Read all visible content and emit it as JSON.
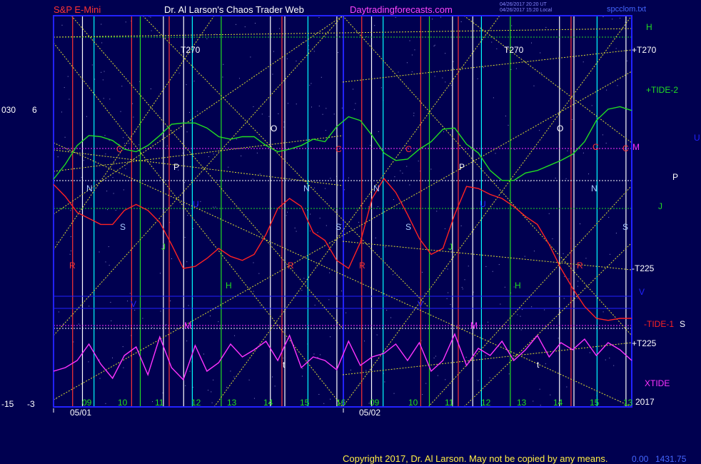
{
  "header": {
    "title_left": "S&P E-Mini",
    "title_center": "Dr. Al Larson's Chaos Trader Web",
    "website": "Daytradingforecasts.com",
    "timestamp_ut": "04/26/2017 20:20 UT",
    "timestamp_local": "04/26/2017 15:20 Local",
    "filename": "spcclom.txt"
  },
  "footer": {
    "copyright": "Copyright 2017, Dr. Al Larson. May not be copied by any means.",
    "readout_a": "0.00",
    "readout_b": "1431.75"
  },
  "colors": {
    "background": "#000050",
    "frame": "#2222ff",
    "price": "#ff2222",
    "tide2": "#22dd22",
    "xtide": "#ff33ff",
    "helix": "#dddd33",
    "title_red": "#ff3333",
    "website_magenta": "#ff44ff",
    "text_white": "#ffffff"
  },
  "chart_data": {
    "type": "line",
    "title": "S&P E-Mini",
    "x_axis": {
      "hour_ticks": [
        "09",
        "10",
        "11",
        "12",
        "13",
        "14",
        "15",
        "16",
        "09",
        "10",
        "11",
        "12",
        "13",
        "14",
        "15",
        "13"
      ],
      "date_labels": [
        "05/01",
        "05/02"
      ],
      "year_label": "2017"
    },
    "y_axis_left": {
      "upper_labels": [
        "030",
        "6"
      ],
      "lower_labels": [
        "-15",
        "-3"
      ]
    },
    "series": [
      {
        "name": "+TIDE-2",
        "color": "#22dd22",
        "values": [
          0.28,
          0.4,
          0.55,
          0.63,
          0.62,
          0.59,
          0.52,
          0.5,
          0.55,
          0.63,
          0.72,
          0.73,
          0.73,
          0.69,
          0.62,
          0.6,
          0.62,
          0.62,
          0.55,
          0.5,
          0.52,
          0.55,
          0.6,
          0.58,
          0.7,
          0.78,
          0.75,
          0.63,
          0.49,
          0.43,
          0.44,
          0.52,
          0.58,
          0.68,
          0.69,
          0.56,
          0.49,
          0.35,
          0.27,
          0.27,
          0.33,
          0.35,
          0.39,
          0.43,
          0.48,
          0.58,
          0.75,
          0.84,
          0.86,
          0.83
        ]
      },
      {
        "name": "-TIDE-1",
        "color": "#ff2222",
        "values": [
          0.72,
          0.66,
          0.58,
          0.55,
          0.52,
          0.52,
          0.59,
          0.62,
          0.59,
          0.53,
          0.42,
          0.3,
          0.31,
          0.35,
          0.4,
          0.36,
          0.34,
          0.37,
          0.47,
          0.6,
          0.65,
          0.61,
          0.48,
          0.44,
          0.34,
          0.3,
          0.43,
          0.65,
          0.75,
          0.68,
          0.57,
          0.45,
          0.37,
          0.4,
          0.57,
          0.71,
          0.7,
          0.67,
          0.65,
          0.61,
          0.56,
          0.52,
          0.42,
          0.3,
          0.2,
          0.11,
          0.05,
          0.04,
          0.05,
          0.05
        ]
      },
      {
        "name": "XTIDE",
        "color": "#ff33ff",
        "values": [
          0.4,
          0.45,
          0.55,
          0.78,
          0.5,
          0.3,
          0.62,
          0.74,
          0.35,
          0.88,
          0.45,
          0.28,
          0.76,
          0.4,
          0.52,
          0.78,
          0.6,
          0.7,
          0.82,
          0.55,
          0.9,
          0.45,
          0.6,
          0.55,
          0.42,
          0.82,
          0.48,
          0.6,
          0.65,
          0.78,
          0.55,
          0.8,
          0.4,
          0.55,
          0.92,
          0.48,
          0.72,
          0.62,
          0.82,
          0.55,
          0.7,
          0.9,
          0.6,
          0.8,
          0.7,
          0.85,
          0.62,
          0.8,
          0.7,
          0.55
        ]
      }
    ],
    "line_labels": {
      "right": [
        "H",
        "+T270",
        "+TIDE-2",
        "U",
        "P",
        "J",
        "-T225",
        "V",
        "-TIDE-1",
        "S",
        "+T225",
        "XTIDE"
      ],
      "top": [
        "T270",
        "T270"
      ],
      "markers": [
        "C",
        "C",
        "C",
        "C",
        "C",
        "M",
        "P",
        "P",
        "O",
        "O",
        "N",
        "N",
        "N",
        "N",
        "S",
        "S",
        "S",
        "S",
        "R",
        "R",
        "R",
        "R",
        "J",
        "J",
        "H",
        "H",
        "V",
        "V",
        "M",
        "M",
        "U",
        "U",
        "t",
        "t"
      ]
    },
    "grid": true
  }
}
